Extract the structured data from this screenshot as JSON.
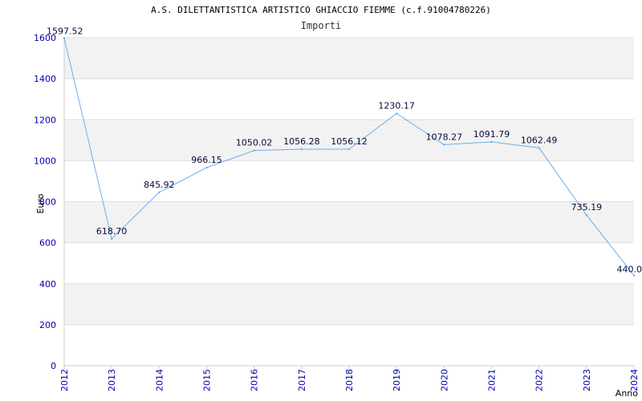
{
  "title": "A.S. DILETTANTISTICA ARTISTICO GHIACCIO FIEMME (c.f.91004780226)",
  "colors": {
    "line": "#6aaeee",
    "band": "#f2f2f2",
    "gridline": "#dddddd",
    "axis": "#cccccc",
    "tick_text": "#0000b0"
  },
  "chart_data": {
    "type": "line",
    "title": "A.S. DILETTANTISTICA ARTISTICO GHIACCIO FIEMME (c.f.91004780226)",
    "subtitle": "Importi",
    "xlabel": "Anno",
    "ylabel": "Euro",
    "ylim": [
      0,
      1600
    ],
    "yticks": [
      0,
      200,
      400,
      600,
      800,
      1000,
      1200,
      1400,
      1600
    ],
    "grid": true,
    "categories": [
      "2012",
      "2013",
      "2014",
      "2015",
      "2016",
      "2017",
      "2018",
      "2019",
      "2020",
      "2021",
      "2022",
      "2023",
      "2024"
    ],
    "series": [
      {
        "values": [
          1597.52,
          618.7,
          845.92,
          966.15,
          1050.02,
          1056.28,
          1056.12,
          1230.17,
          1078.27,
          1091.79,
          1062.49,
          735.19,
          440.0
        ],
        "labels": [
          "1597.52",
          "618.70",
          "845.92",
          "966.15",
          "1050.02",
          "1056.28",
          "1056.12",
          "1230.17",
          "1078.27",
          "1091.79",
          "1062.49",
          "735.19",
          "440.0"
        ]
      }
    ]
  }
}
